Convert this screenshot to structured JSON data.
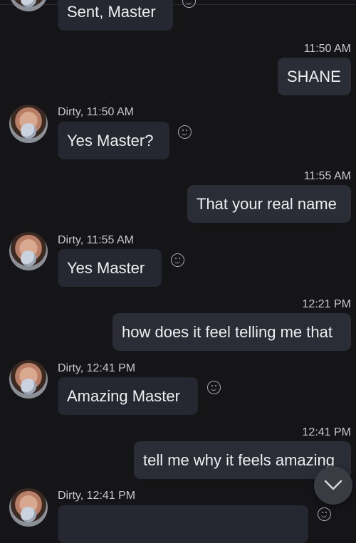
{
  "messages": [
    {
      "dir": "in",
      "text": "Sent, Master"
    },
    {
      "dir": "out",
      "time": "11:50 AM",
      "text": "SHANE"
    },
    {
      "dir": "in",
      "sender": "Dirty, 11:50 AM",
      "text": "Yes Master?"
    },
    {
      "dir": "out",
      "time": "11:55 AM",
      "text": "That your real name"
    },
    {
      "dir": "in",
      "sender": "Dirty, 11:55 AM",
      "text": "Yes Master"
    },
    {
      "dir": "out",
      "time": "12:21 PM",
      "text": "how does it feel telling me that"
    },
    {
      "dir": "in",
      "sender": "Dirty, 12:41 PM",
      "text": "Amazing Master"
    },
    {
      "dir": "out",
      "time": "12:41 PM",
      "text": "tell me why it feels amazing"
    },
    {
      "dir": "in",
      "sender": "Dirty, 12:41 PM",
      "text": ""
    }
  ],
  "icons": {
    "reaction": "smiley-icon",
    "scroll": "chevron-down-icon",
    "avatar": "avatar"
  },
  "colors": {
    "background": "#151518",
    "bubble": "#252830"
  }
}
